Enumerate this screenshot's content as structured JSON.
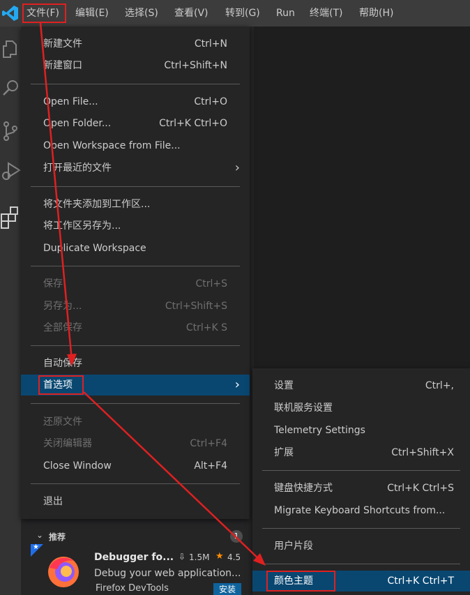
{
  "menubar": {
    "items": [
      "文件(F)",
      "编辑(E)",
      "选择(S)",
      "查看(V)",
      "转到(G)",
      "Run",
      "终端(T)",
      "帮助(H)"
    ]
  },
  "activity_icons": [
    "files-icon",
    "search-icon",
    "source-control-icon",
    "run-debug-icon",
    "extensions-icon"
  ],
  "file_menu": {
    "items": [
      {
        "label": "新建文件",
        "shortcut": "Ctrl+N",
        "enabled": true
      },
      {
        "label": "新建窗口",
        "shortcut": "Ctrl+Shift+N",
        "enabled": true
      },
      {
        "label": "Open File...",
        "shortcut": "Ctrl+O",
        "enabled": true
      },
      {
        "label": "Open Folder...",
        "shortcut": "Ctrl+K Ctrl+O",
        "enabled": true
      },
      {
        "label": "Open Workspace from File...",
        "shortcut": "",
        "enabled": true
      },
      {
        "label": "打开最近的文件",
        "shortcut": "›",
        "enabled": true
      },
      {
        "label": "将文件夹添加到工作区...",
        "shortcut": "",
        "enabled": true
      },
      {
        "label": "将工作区另存为...",
        "shortcut": "",
        "enabled": true
      },
      {
        "label": "Duplicate Workspace",
        "shortcut": "",
        "enabled": true
      },
      {
        "label": "保存",
        "shortcut": "Ctrl+S",
        "enabled": false
      },
      {
        "label": "另存为...",
        "shortcut": "Ctrl+Shift+S",
        "enabled": false
      },
      {
        "label": "全部保存",
        "shortcut": "Ctrl+K S",
        "enabled": false
      },
      {
        "label": "自动保存",
        "shortcut": "",
        "enabled": true
      },
      {
        "label": "首选项",
        "shortcut": "›",
        "enabled": true,
        "selected": true
      },
      {
        "label": "还原文件",
        "shortcut": "",
        "enabled": false
      },
      {
        "label": "关闭编辑器",
        "shortcut": "Ctrl+F4",
        "enabled": false
      },
      {
        "label": "Close Window",
        "shortcut": "Alt+F4",
        "enabled": true
      },
      {
        "label": "退出",
        "shortcut": "",
        "enabled": true
      }
    ]
  },
  "prefs_menu": {
    "items": [
      {
        "label": "设置",
        "shortcut": "Ctrl+,"
      },
      {
        "label": "联机服务设置",
        "shortcut": ""
      },
      {
        "label": "Telemetry Settings",
        "shortcut": ""
      },
      {
        "label": "扩展",
        "shortcut": "Ctrl+Shift+X"
      },
      {
        "label": "键盘快捷方式",
        "shortcut": "Ctrl+K Ctrl+S"
      },
      {
        "label": "Migrate Keyboard Shortcuts from...",
        "shortcut": ""
      },
      {
        "label": "用户片段",
        "shortcut": ""
      },
      {
        "label": "颜色主题",
        "shortcut": "Ctrl+K Ctrl+T",
        "selected": true
      }
    ]
  },
  "extensions_panel": {
    "section_title": "推荐",
    "badge": "1",
    "card": {
      "name": "Debugger fo...",
      "downloads": "1.5M",
      "rating": "4.5",
      "description": "Debug your web application...",
      "publisher": "Firefox DevTools",
      "install_label": "安装"
    }
  },
  "colors": {
    "accent_selection": "#094771",
    "annotation": "#e02020",
    "menubar": "#3c3c3c",
    "menu_bg": "#252526"
  }
}
